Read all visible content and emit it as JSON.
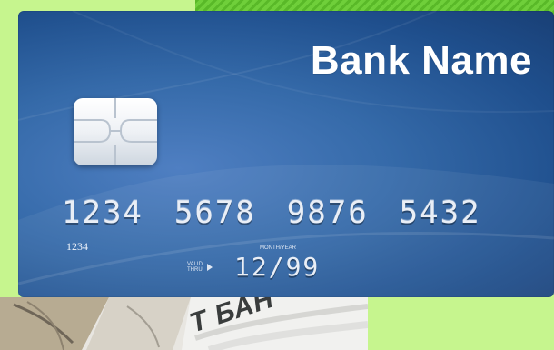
{
  "card": {
    "bank_name": "Bank Name",
    "number_groups": [
      "1234",
      "5678",
      "9876",
      "5432"
    ],
    "small_number": "1234",
    "valid_label": "VALID THRU",
    "month_year_label": "MONTH/YEAR",
    "expiry": "12/99",
    "colors": {
      "card_blue": "#356aa9",
      "chip": "#ffffff"
    }
  },
  "banknote": {
    "visible_text": "T БАН"
  },
  "background": {
    "panel_color": "#c6f58e",
    "stripe_color": "#59b928"
  }
}
